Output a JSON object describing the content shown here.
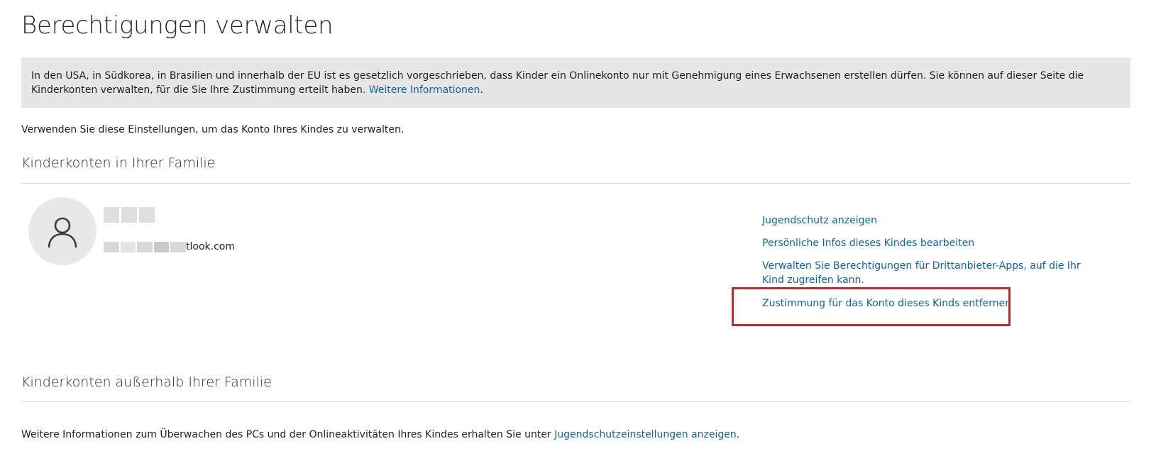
{
  "page": {
    "title": "Berechtigungen verwalten"
  },
  "notice": {
    "text": "In den USA, in Südkorea, in Brasilien und innerhalb der EU ist es gesetzlich vorgeschrieben, dass Kinder ein Onlinekonto nur mit Genehmigung eines Erwachsenen erstellen dürfen. Sie können auf dieser Seite die Kinderkonten verwalten, für die Sie Ihre Zustimmung erteilt haben. ",
    "link_label": "Weitere Informationen",
    "trailing": "."
  },
  "intro": {
    "text": "Verwenden Sie diese Einstellungen, um das Konto Ihres Kindes zu verwalten."
  },
  "in_family": {
    "heading": "Kinderkonten in Ihrer Familie",
    "child": {
      "avatar_icon": "person-icon",
      "email_visible_suffix": "tlook.com"
    },
    "actions": [
      {
        "label": "Jugendschutz anzeigen"
      },
      {
        "label": "Persönliche Infos dieses Kindes bearbeiten"
      },
      {
        "label": "Verwalten Sie Berechtigungen für Drittanbieter-Apps, auf die Ihr Kind zugreifen kann."
      },
      {
        "label": "Zustimmung für das Konto dieses Kinds entfernen"
      }
    ]
  },
  "outside_family": {
    "heading": "Kinderkonten außerhalb Ihrer Familie"
  },
  "footer": {
    "text": "Weitere Informationen zum Überwachen des PCs und der Onlineaktivitäten Ihres Kindes erhalten Sie unter ",
    "link_label": "Jugendschutzeinstellungen anzeigen",
    "trailing": "."
  },
  "colors": {
    "link": "#0f62a8",
    "notice_background": "#e6e6e6",
    "highlight": "#e01b1b"
  }
}
